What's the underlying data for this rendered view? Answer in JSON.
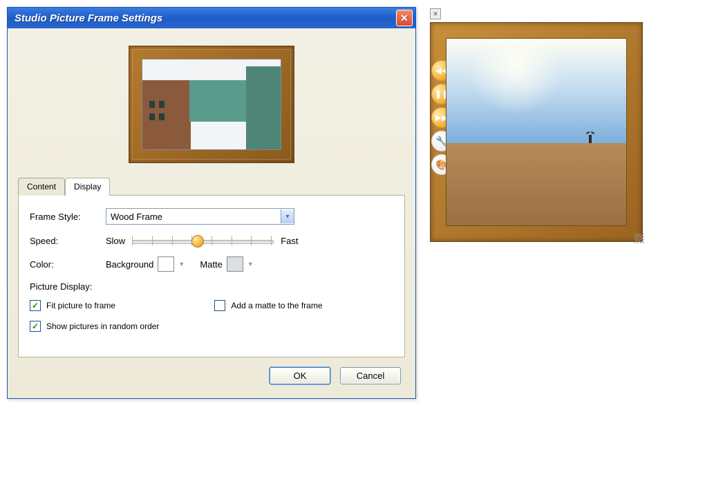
{
  "dialog": {
    "title": "Studio Picture Frame Settings",
    "tabs": {
      "content": "Content",
      "display": "Display"
    },
    "fields": {
      "frame_style_label": "Frame Style:",
      "frame_style_value": "Wood Frame",
      "speed_label": "Speed:",
      "speed_slow": "Slow",
      "speed_fast": "Fast",
      "color_label": "Color:",
      "color_background": "Background",
      "color_matte": "Matte",
      "picture_display_label": "Picture Display:",
      "fit_label": "Fit picture to frame",
      "matte_checkbox_label": "Add a matte to the frame",
      "random_label": "Show pictures in random order"
    },
    "checkbox_state": {
      "fit": true,
      "matte": false,
      "random": true
    },
    "buttons": {
      "ok": "OK",
      "cancel": "Cancel"
    },
    "colors": {
      "background_swatch": "#ffffff",
      "matte_swatch": "#d9e1e5"
    }
  },
  "live_frame": {
    "icons": {
      "back": "back-icon",
      "pause": "pause-icon",
      "forward": "forward-icon",
      "settings": "wrench-icon",
      "palette": "palette-icon"
    }
  }
}
